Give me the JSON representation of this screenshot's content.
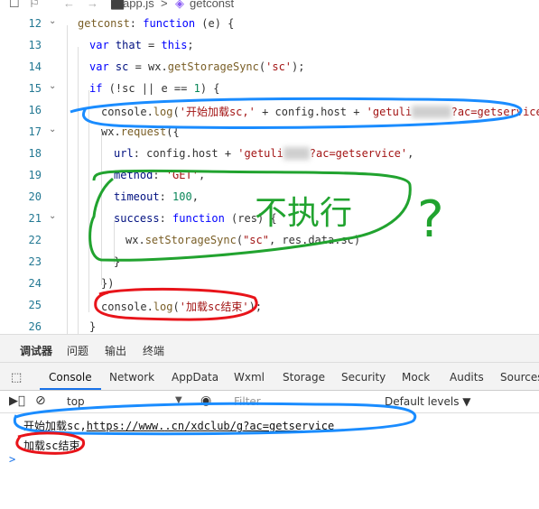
{
  "topbar": {
    "file": "app.js",
    "separator": ">",
    "symbol": "getconst"
  },
  "lines": [
    {
      "n": "12",
      "html": "getconst: function (e) {"
    },
    {
      "n": "13",
      "html": "var that = this;"
    },
    {
      "n": "14",
      "html": "var sc = wx.getStorageSync('sc');"
    },
    {
      "n": "15",
      "html": "if (!sc || e == 1) {"
    },
    {
      "n": "16",
      "html": "console.log('开始加载sc,' + config.host + 'getuli        ?ac=getservice');"
    },
    {
      "n": "17",
      "html": "wx.request({"
    },
    {
      "n": "18",
      "html": "url: config.host + 'getuli      ?ac=getservice',"
    },
    {
      "n": "19",
      "html": "method: 'GET',"
    },
    {
      "n": "20",
      "html": "timeout: 100,"
    },
    {
      "n": "21",
      "html": "success: function (res) {"
    },
    {
      "n": "22",
      "html": "wx.setStorageSync(\"sc\", res.data.sc)"
    },
    {
      "n": "23",
      "html": "}"
    },
    {
      "n": "24",
      "html": "})"
    },
    {
      "n": "25",
      "html": "console.log('加载sc结束');"
    },
    {
      "n": "26",
      "html": "}"
    }
  ],
  "devtools": {
    "tabs": [
      "调试器",
      "问题",
      "输出",
      "终端"
    ],
    "console_tabs": [
      "Console",
      "Network",
      "AppData",
      "Wxml",
      "Storage",
      "Security",
      "Mock",
      "Audits",
      "Sources"
    ],
    "context": "top",
    "filter_placeholder": "Filter",
    "levels": "Default levels ▼"
  },
  "console_output": {
    "line1_prefix": "开始加载sc,",
    "line1_link": "https://www.",
    "line1_mid": ".cn/xdclub/g",
    "line1_tail": "?ac=getservice",
    "line2": "加载sc结束",
    "prompt": ">"
  },
  "annotations": {
    "handwriting": "不执行",
    "question": "?"
  }
}
